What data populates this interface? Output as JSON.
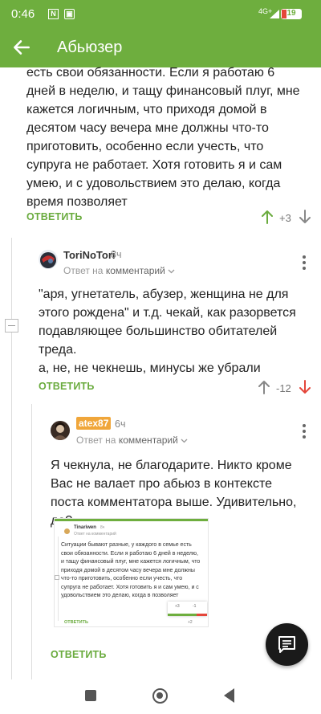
{
  "status_bar": {
    "time": "0:46",
    "network": "4G+",
    "battery": "19"
  },
  "app_bar": {
    "title": "Абьюзер",
    "back_icon": "arrow-left-icon"
  },
  "parent_comment": {
    "text": "есть свои обязанности. Если я работаю 6 дней в неделю, и тащу финансовый плуг, мне кажется логичным, что приходя домой в десятом часу вечера мне должны что-то приготовить, особенно если учесть, что супруга не работает. Хотя готовить я и сам умею, и с удовольствием это делаю, когда время позволяет",
    "reply_label": "ОТВЕТИТЬ",
    "score": "+3"
  },
  "comment_1": {
    "username": "ToriNoTori",
    "time": "8ч",
    "reply_to_prefix": "Ответ на",
    "reply_to_target": "комментарий",
    "text": "\"аря, угнетатель, абузер,  женщина не для этого рождена\" и т.д. чекай, как разорвется подавляющее большинство обитателей треда.\nа, не, не чекнешь, минусы же убрали",
    "reply_label": "ОТВЕТИТЬ",
    "score": "-12"
  },
  "comment_2": {
    "username": "atex87",
    "time": "6ч",
    "reply_to_prefix": "Ответ на",
    "reply_to_target": "комментарий",
    "text": "Я чекнула, не благодарите. Никто кроме Вас не валает про абьюз в контексте поста комментатора выше. Удивительно, да?",
    "reply_label": "ОТВЕТИТЬ"
  },
  "embedded_screenshot": {
    "username": "Tinariwen",
    "time": "8ч",
    "reply_to": "Ответ на комментарий",
    "text": "Ситуации бывают разные, у каждого в семье есть свои обязанности. Если я работаю 6 дней в неделю, и тащу финансовый плуг, мне кажется логичным, что приходя домой в десятом часу вечера мне должны что-то приготовить, особенно если учесть, что супруга не работает. Хотя готовить я и сам умею, и с удовольствием это делаю, когда в позволяет",
    "reply_label": "ОТВЕТИТЬ",
    "score": "+2",
    "popup_plus": "+3",
    "popup_minus": "-1"
  },
  "colors": {
    "brand_green": "#6eae3e",
    "downvote_red": "#e4463a",
    "nick_badge": "#f0a63a"
  },
  "icons": {
    "fab": "comment-icon",
    "upvote": "arrow-up-icon",
    "downvote": "arrow-down-icon",
    "more": "more-vertical-icon"
  }
}
